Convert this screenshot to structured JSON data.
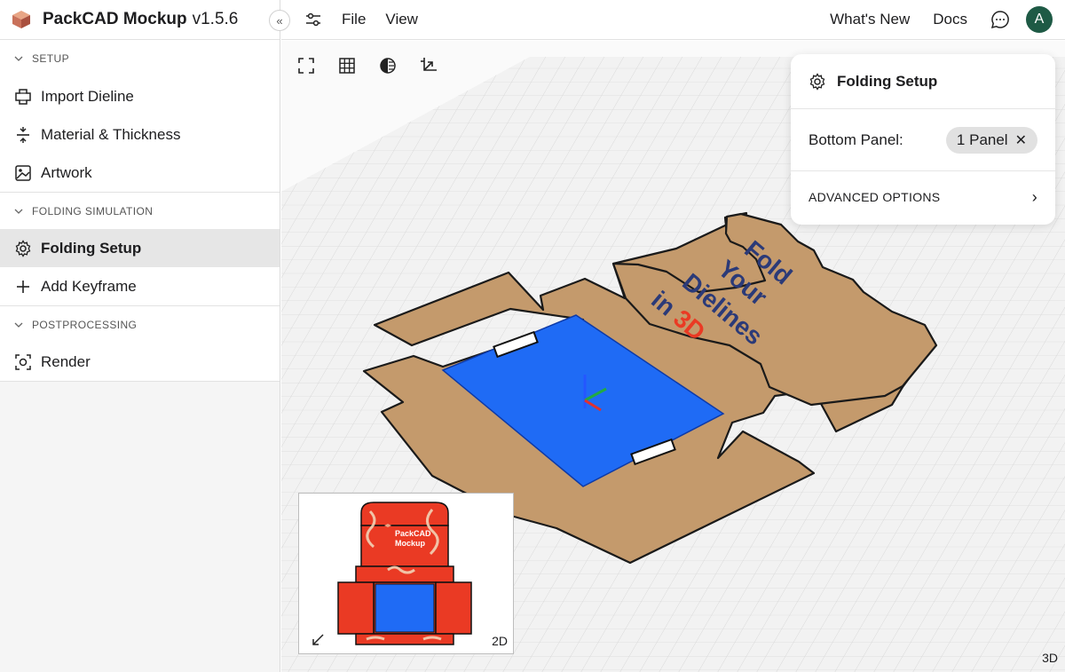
{
  "app": {
    "name": "PackCAD Mockup",
    "version": "v1.5.6"
  },
  "topbar": {
    "file": "File",
    "view": "View",
    "whats_new": "What's New",
    "docs": "Docs",
    "avatar_initial": "A"
  },
  "sidebar": {
    "sections": [
      {
        "title": "SETUP",
        "items": [
          "Import Dieline",
          "Material & Thickness",
          "Artwork"
        ]
      },
      {
        "title": "FOLDING SIMULATION",
        "items": [
          "Folding Setup",
          "Add Keyframe"
        ]
      },
      {
        "title": "POSTPROCESSING",
        "items": [
          "Render"
        ]
      }
    ],
    "active": "Folding Setup"
  },
  "folding_panel": {
    "title": "Folding Setup",
    "bottom_panel_label": "Bottom Panel:",
    "bottom_panel_value": "1 Panel",
    "advanced": "ADVANCED OPTIONS"
  },
  "model_text": {
    "line1": "Fold",
    "line2": "Your",
    "line3": "Dielines",
    "line4_a": "in ",
    "line4_b": "3D"
  },
  "minimap": {
    "label": "2D",
    "brand_line1": "PackCAD",
    "brand_line2": "Mockup"
  },
  "viewport": {
    "mode_label": "3D"
  },
  "colors": {
    "cardboard": "#c49a6c",
    "base_blue": "#1f6bf5",
    "accent_red": "#ea3a24",
    "text_navy": "#2b3a78",
    "avatar": "#1e5a45"
  }
}
